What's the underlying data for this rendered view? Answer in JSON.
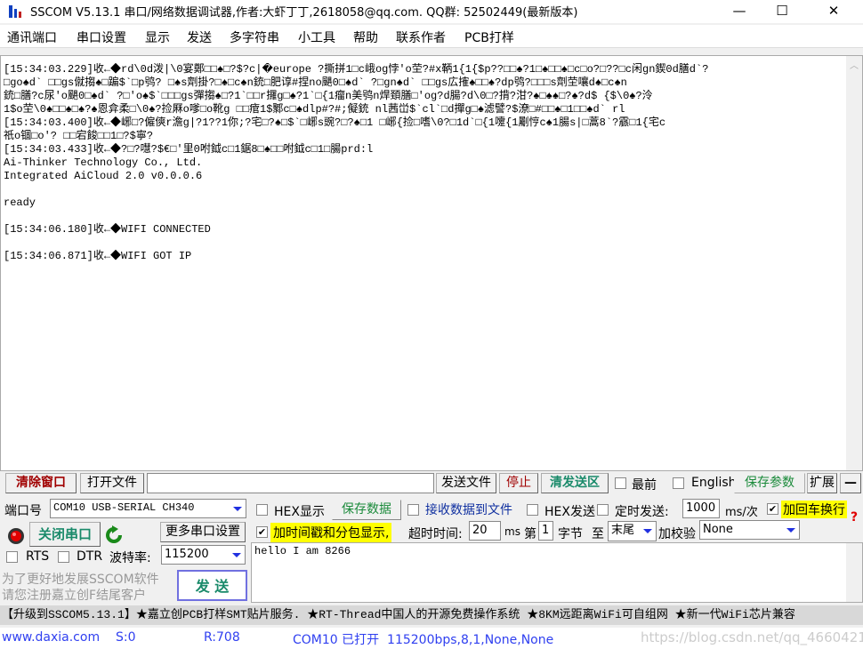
{
  "window": {
    "title": "SSCOM V5.13.1 串口/网络数据调试器,作者:大虾丁丁,2618058@qq.com. QQ群: 52502449(最新版本)",
    "minimize": "—",
    "maximize": "☐",
    "close": "✕"
  },
  "menu": [
    "通讯端口",
    "串口设置",
    "显示",
    "发送",
    "多字符串",
    "小工具",
    "帮助",
    "联系作者",
    "PCB打样"
  ],
  "receive_lines": [
    "[15:34:03.229]收←◆rd\\0d泼|\\0宴鄭□□♠□?$?c|�europe ?撕拼1□c峨og悖'o茔?#x鞆1{1{$p??□□♠?1□♠□□♠□c□o?□??□c闲gn鍥0d膳d`?",
    "□go♠d` □□gs僦搊♠□蹁$`□p鸮? □♠s劑掛?□♠□c♠n銃□肥谆#捏no颶0□♠d` ?□gn♠d` □□gs広搉♠□□♠?dp鸮?□□□s劑茔嚷d♠□c♠n",
    "銃□膳?c尿'o颶0□♠d` ?□'o♠$`□□□gs彈搊♠□?1`□□r攞g□♠?1`□{1瘤n美鸮n焊頚膳□'og?d腸?d\\0□?揹?泔?♠□♠♠□?♠?d$ {$\\0♠?泠",
    "1$o茔\\0♠□□♠□♠?♠恩弇柔□\\0♠?捡厤o嗲□o靴g □□痯1$鄹c□♠dlp#?#;儗銃 nl茜峃$`cl`□d撣g□♠滤譬?$潦□#□□♠□1□□♠d` rl",
    "[15:34:03.400]收←◆峫□?僱傸r澹g|?1??1你;?宅□?♠□$`□峫s豌?□?♠□1 □峫{捡□嗜\\0?□1d`□{1嚔{1劚悙c♠1腸s|□蒿8`?霢□1{宅c",
    "祇o锢□o'? □□宕餕□□1□?$寧?",
    "[15:34:03.433]收←◆?□?嚖?$€□'里0咐鉞c□1鋸8□♠□□咐鉞c□1□腸prd:l",
    "Ai-Thinker Technology Co., Ltd.",
    "Integrated AiCloud 2.0 v0.0.0.6",
    "",
    "ready",
    "",
    "[15:34:06.180]收←◆WIFI CONNECTED",
    "",
    "[15:34:06.871]收←◆WIFI GOT IP",
    ""
  ],
  "toolbar": {
    "clear": "清除窗口",
    "open_file": "打开文件",
    "file_path": "",
    "send_file": "发送文件",
    "stop": "停止",
    "clear_send": "清发送区",
    "topmost": "最前",
    "english": "English",
    "save_params": "保存参数",
    "expand": "扩展",
    "collapse": "—"
  },
  "port": {
    "label": "端口号",
    "value": "COM10 USB-SERIAL CH340",
    "close_port": "关闭串口",
    "more_settings": "更多串口设置",
    "rts": "RTS",
    "dtr": "DTR",
    "baud_label": "波特率:",
    "baud": "115200"
  },
  "promo": {
    "line1": "为了更好地发展SSCOM软件",
    "line2": "请您注册嘉立创F结尾客户"
  },
  "send_button": "发 送",
  "options": {
    "hex_display": "HEX显示",
    "save_data": "保存数据",
    "recv_to_file": "接收数据到文件",
    "hex_send": "HEX发送",
    "timed_send": "定时发送:",
    "interval": "1000",
    "interval_unit": "ms/次",
    "add_crlf": "加回车换行",
    "add_crlf_checked": true,
    "timestamp": "加时间戳和分包显示,",
    "timestamp_checked": true,
    "timeout_label": "超时时间:",
    "timeout": "20",
    "timeout_unit": "ms",
    "byte_prefix": "第",
    "byte_index": "1",
    "byte_suffix": "字节",
    "to_label": "至",
    "to_value": "末尾",
    "checksum_label": "加校验",
    "checksum": "None",
    "help": "?"
  },
  "send_text": "hello I am 8266",
  "ticker": "【升级到SSCOM5.13.1】★嘉立创PCB打样SMT贴片服务. ★RT-Thread中国人的开源免费操作系统 ★8KM远距离WiFi可自组网 ★新一代WiFi芯片兼容",
  "status": {
    "site": "www.daxia.com",
    "sent": "S:0",
    "received": "R:708",
    "port_state": "COM10 已打开  115200bps,8,1,None,None",
    "watermark": "https://blog.csdn.net/qq_46604211"
  },
  "colors": {
    "accent_red": "#a00000",
    "accent_green": "#1a8a6a",
    "link_blue": "#3040f0",
    "highlight_yellow": "#ffff00"
  }
}
